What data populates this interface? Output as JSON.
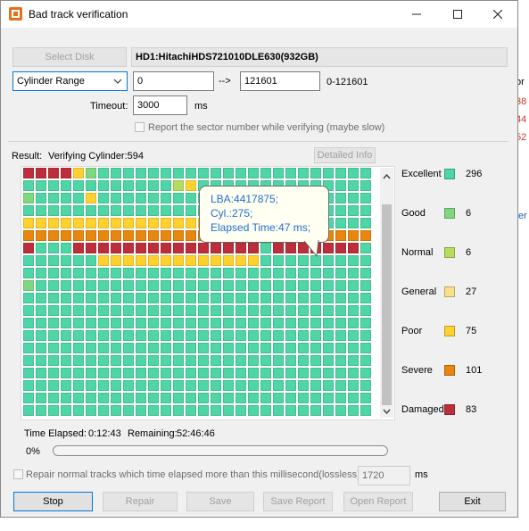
{
  "window": {
    "title": "Bad track verification"
  },
  "background": {
    "fragments": [
      "or",
      "38",
      "44",
      "52",
      "ter"
    ]
  },
  "controls": {
    "select_disk": "Select Disk",
    "disk_name": "HD1:HitachiHDS721010DLE630(932GB)",
    "mode": "Cylinder Range",
    "from": "0",
    "arrow": "-->",
    "to": "121601",
    "range_label": "0-121601",
    "timeout_label": "Timeout:",
    "timeout_value": "3000",
    "timeout_unit": "ms",
    "report_sector_label": "Report the sector number while verifying (maybe slow)"
  },
  "result": {
    "label": "Result:",
    "status": "Verifying Cylinder:594",
    "detailed_info": "Detailed Info"
  },
  "tooltip": {
    "lines": [
      "LBA:4417875;",
      "Cyl.:275;",
      "Elapsed Time:47 ms;"
    ]
  },
  "legend": [
    {
      "label": "Excellent",
      "count": "296",
      "color": "#4fd6a6"
    },
    {
      "label": "Good",
      "count": "6",
      "color": "#7fd87f"
    },
    {
      "label": "Normal",
      "count": "6",
      "color": "#b5dc5e"
    },
    {
      "label": "General",
      "count": "27",
      "color": "#f8e08a"
    },
    {
      "label": "Poor",
      "count": "75",
      "color": "#ffd12e"
    },
    {
      "label": "Severe",
      "count": "101",
      "color": "#e8860e"
    },
    {
      "label": "Damaged",
      "count": "83",
      "color": "#bd2e3c"
    }
  ],
  "progress": {
    "time_elapsed_label": "Time Elapsed:",
    "time_elapsed": "0:12:43",
    "remaining_label": "Remaining:",
    "remaining": "52:46:46",
    "percent_text": "0%",
    "fraction": 0.0
  },
  "repair": {
    "label": "Repair normal tracks which time elapsed more than this millisecond(lossless):",
    "value": "1720",
    "unit": "ms"
  },
  "buttons": {
    "stop": "Stop",
    "repair": "Repair",
    "save": "Save",
    "save_report": "Save Report",
    "open_report": "Open Report",
    "exit": "Exit"
  },
  "grid": {
    "columns": 28,
    "rows": 20,
    "filled_cells": 594,
    "status_map": "DDDDPGEEEEEEEEEEEEEEEEEEEEEE EEEEEEEEEEEENPEEEEEEEEEEEEEE GEEEEPEEEEEEEEEEEEEEEEEEEEEE EEEEEEEEEEEEEEEEEEEEEEEEEEEE PPPPPPPPPPPPPPPPPPPEEEEEEEEE SSSSSSSSSSSSSSSSSSSSSSSSSSSS DEEEDDDDDDDDDDDDDDDEDDDDDDDE EEEEEEPPPPPPPPPPPPPEEEEEEEEE EEEEEEEEEEEEEEEEEEEEEEEEEEEE GEEEEEEEEEEEEEEEEEEEEEEEEEEE EEEEEEEEEEEEEEEEEEEEEEEEEEEE EEEEEEEEEEEEEEEEEEEEEEEEEEEE EEEEEEEEEEEEEEEEEEEEEEEEEEEE EEEEEEEEEEEEEEEEEEEEEEEEEEEE EEEEEEEEEEEEEEEEEEEEEEEEEEEE EEEEEEEEEEEEEEEEEEEEEEEEEEEE EEEEEEEEEEEEEEEEEEEEEEEEEEEE EEEEEEEEEEEEEEEEEEEEEEEEEEEE EEEEEEEEEEEEEEEEEEEEEEEEEEEE EEEEEEEEEEEEEEEEEEEEEEEEEEEE"
  }
}
